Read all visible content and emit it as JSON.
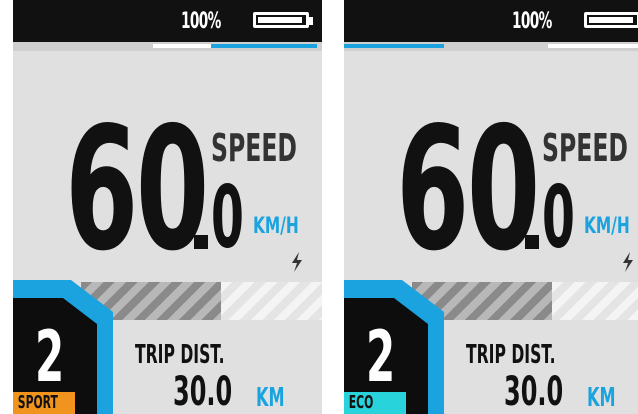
{
  "panels": [
    {
      "battery": {
        "text": "100%",
        "level": 0.92
      },
      "speed": {
        "integer": "60",
        "decimal": "0",
        "label": "SPEED",
        "unit": "KM/H"
      },
      "assist": {
        "level": "2",
        "mode": "SPORT",
        "mode_color": "#f0941d"
      },
      "trip": {
        "label": "TRIP DIST.",
        "value": "30.0",
        "unit": "KM"
      },
      "progress": {
        "accent": "#1aa3df"
      }
    },
    {
      "battery": {
        "text": "100%",
        "level": 0.92
      },
      "speed": {
        "integer": "60",
        "decimal": "0",
        "label": "SPEED",
        "unit": "KM/H"
      },
      "assist": {
        "level": "2",
        "mode": "ECO",
        "mode_color": "#29d3dc"
      },
      "trip": {
        "label": "TRIP DIST.",
        "value": "30.0",
        "unit": "KM"
      },
      "progress": {
        "accent": "#1aa3df"
      }
    }
  ],
  "icons": {
    "battery": "battery-icon",
    "bolt": "lightning-bolt-icon"
  }
}
